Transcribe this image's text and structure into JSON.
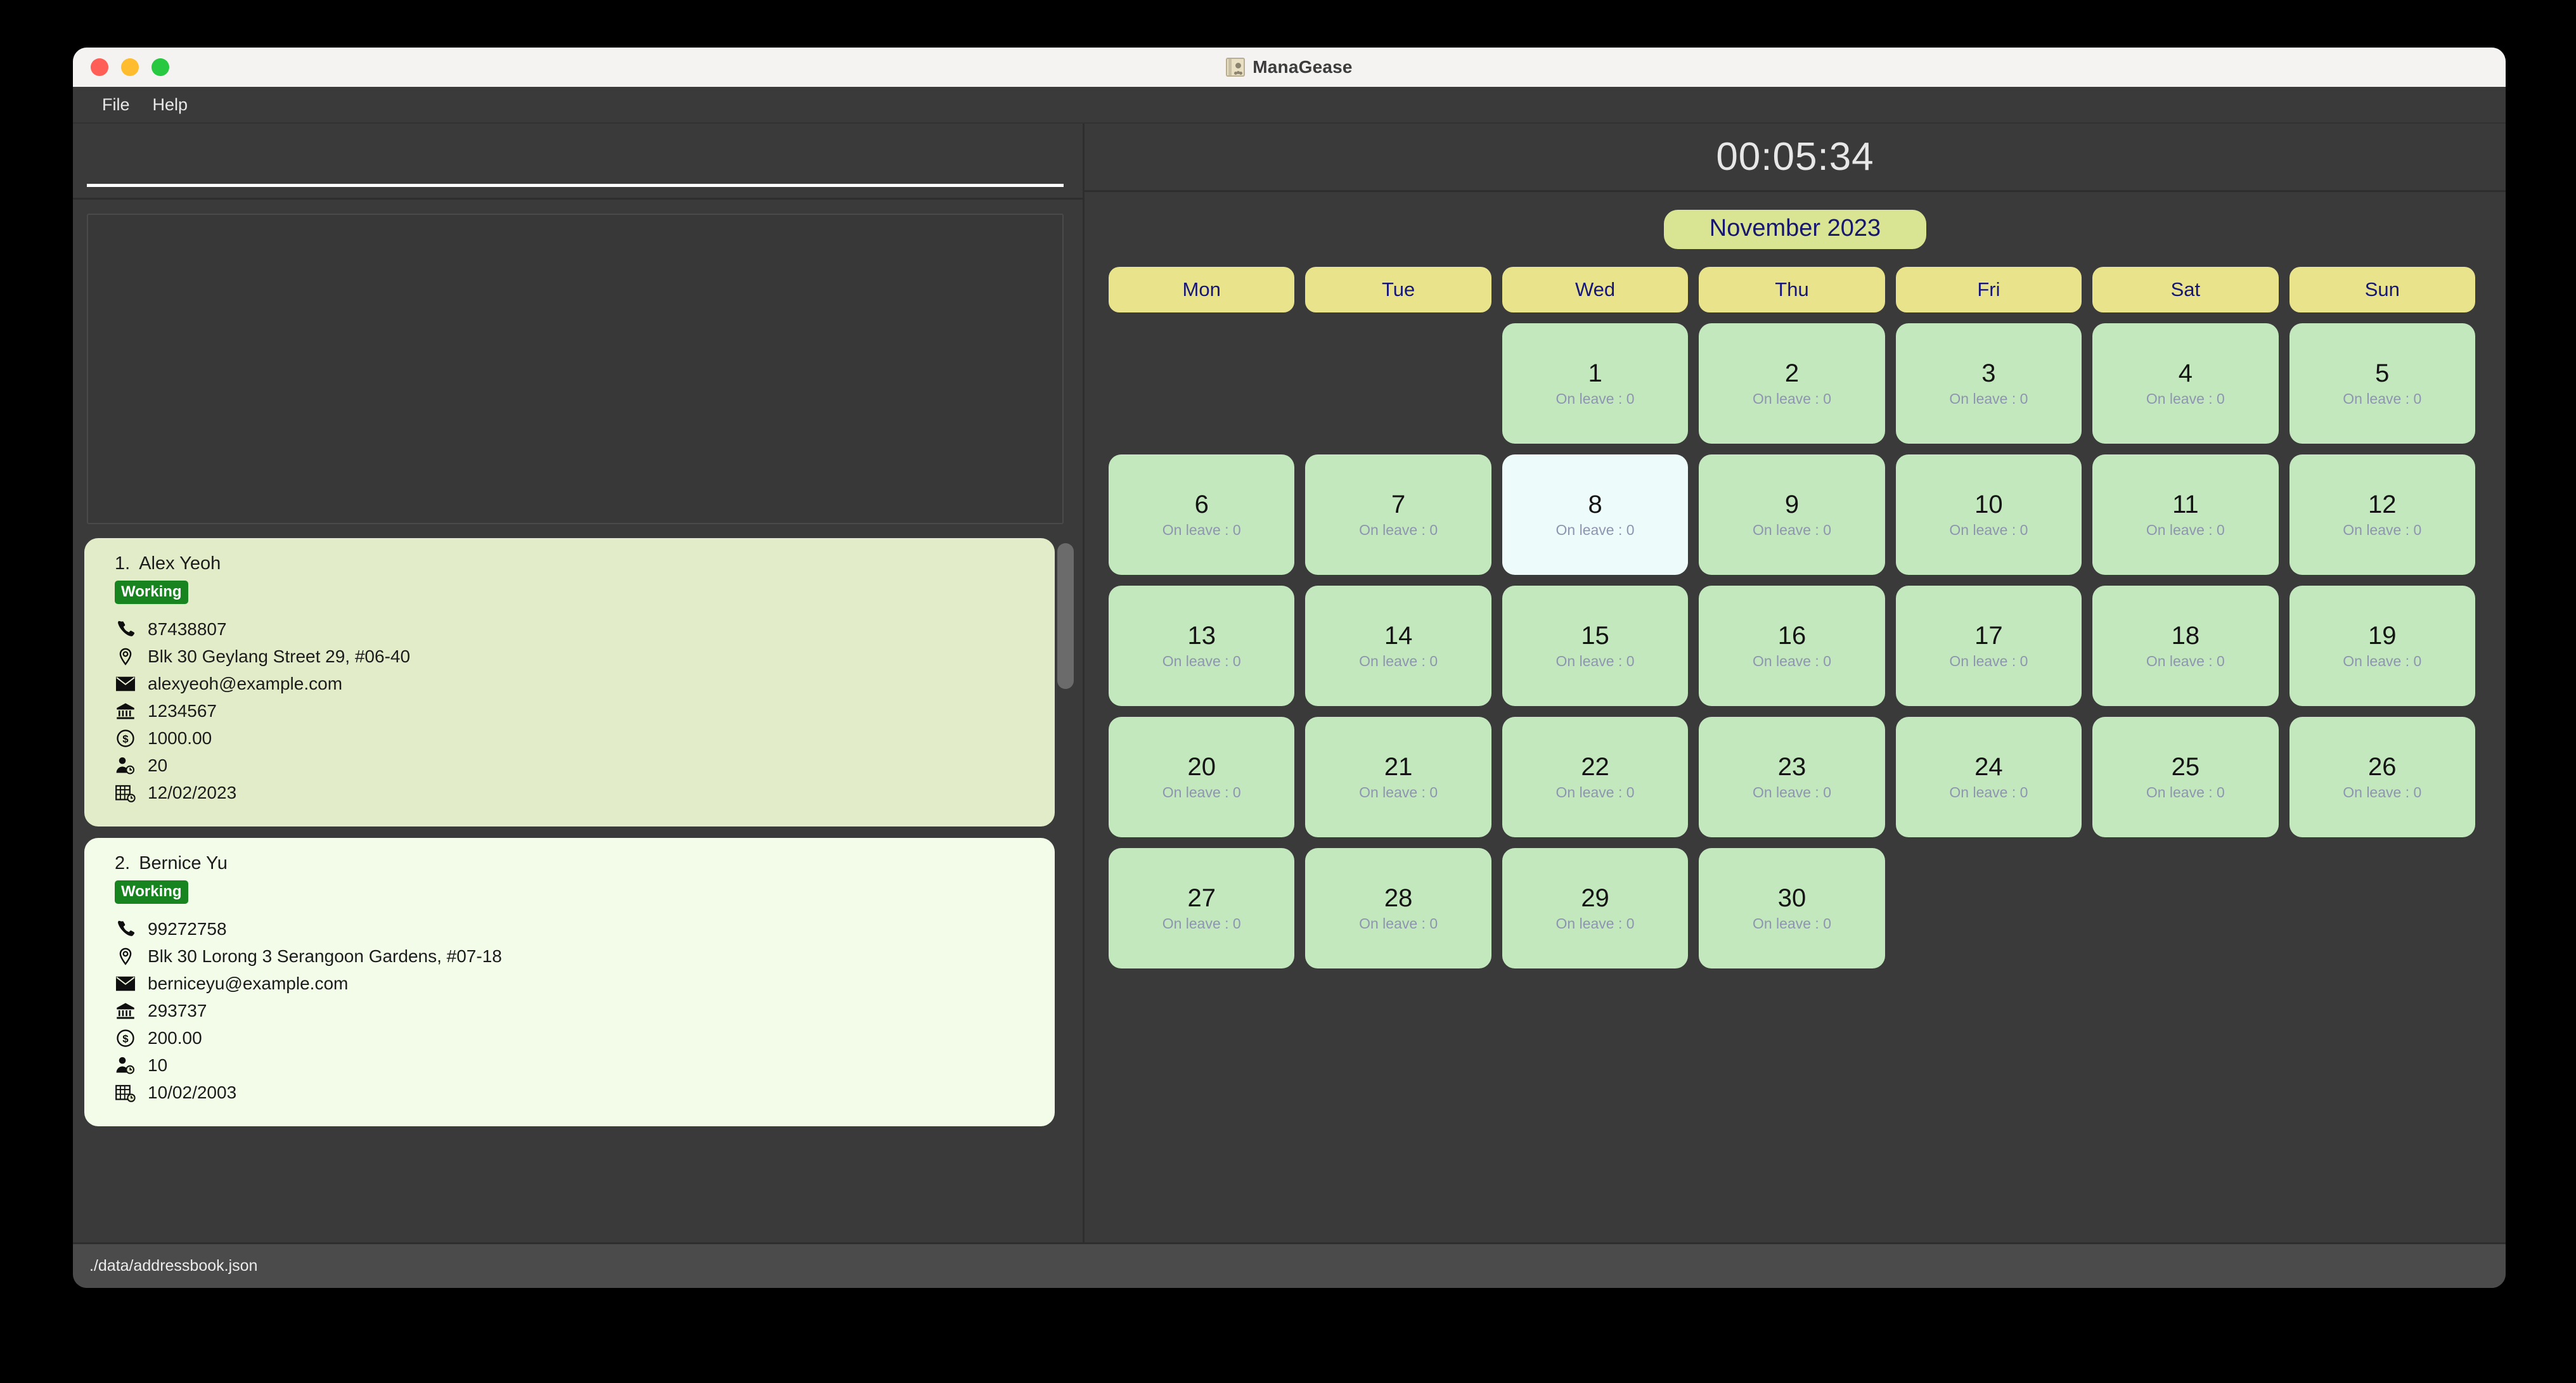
{
  "window": {
    "title": "ManaGease",
    "app_icon": "address-book-icon",
    "traffic_lights": [
      "close",
      "minimize",
      "maximize"
    ]
  },
  "menu": {
    "items": [
      {
        "label": "File"
      },
      {
        "label": "Help"
      }
    ]
  },
  "command": {
    "value": "",
    "placeholder": ""
  },
  "result": {
    "text": ""
  },
  "persons": [
    {
      "index": "1.",
      "name": "Alex Yeoh",
      "status": "Working",
      "phone": "87438807",
      "address": "Blk 30 Geylang Street 29, #06-40",
      "email": "alexyeoh@example.com",
      "bank": "1234567",
      "salary": "1000.00",
      "leaves": "20",
      "date": "12/02/2023",
      "selected": true
    },
    {
      "index": "2.",
      "name": "Bernice Yu",
      "status": "Working",
      "phone": "99272758",
      "address": "Blk 30 Lorong 3 Serangoon Gardens, #07-18",
      "email": "berniceyu@example.com",
      "bank": "293737",
      "salary": "200.00",
      "leaves": "10",
      "date": "10/02/2003",
      "selected": false
    }
  ],
  "field_icons": {
    "phone": "phone-icon",
    "address": "location-pin-icon",
    "email": "envelope-icon",
    "bank": "bank-icon",
    "salary": "dollar-coin-icon",
    "leaves": "person-clock-icon",
    "date": "calendar-clock-icon"
  },
  "timer": {
    "value": "00:05:34"
  },
  "calendar": {
    "month_label": "November 2023",
    "day_headers": [
      "Mon",
      "Tue",
      "Wed",
      "Thu",
      "Fri",
      "Sat",
      "Sun"
    ],
    "leave_label_prefix": "On leave : ",
    "today": 8,
    "weeks": [
      [
        null,
        null,
        1,
        2,
        3,
        4,
        5
      ],
      [
        6,
        7,
        8,
        9,
        10,
        11,
        12
      ],
      [
        13,
        14,
        15,
        16,
        17,
        18,
        19
      ],
      [
        20,
        21,
        22,
        23,
        24,
        25,
        26
      ],
      [
        27,
        28,
        29,
        30,
        null,
        null,
        null
      ]
    ],
    "leave_counts": {
      "1": 0,
      "2": 0,
      "3": 0,
      "4": 0,
      "5": 0,
      "6": 0,
      "7": 0,
      "8": 0,
      "9": 0,
      "10": 0,
      "11": 0,
      "12": 0,
      "13": 0,
      "14": 0,
      "15": 0,
      "16": 0,
      "17": 0,
      "18": 0,
      "19": 0,
      "20": 0,
      "21": 0,
      "22": 0,
      "23": 0,
      "24": 0,
      "25": 0,
      "26": 0,
      "27": 0,
      "28": 0,
      "29": 0,
      "30": 0
    }
  },
  "status_bar": {
    "path": "./data/addressbook.json"
  },
  "colors": {
    "window_bg": "#3a3a3a",
    "title_bar": "#f4f3f1",
    "card_selected": "#e2ecc9",
    "card_normal": "#f2fce9",
    "badge_working": "#17841f",
    "day_header": "#e9e48c",
    "day_cell": "#c3e8be",
    "day_today": "#edfbfa",
    "month_pill": "#d9e592",
    "accent_navy": "#16167a",
    "status_bar": "#4b4b4b"
  }
}
